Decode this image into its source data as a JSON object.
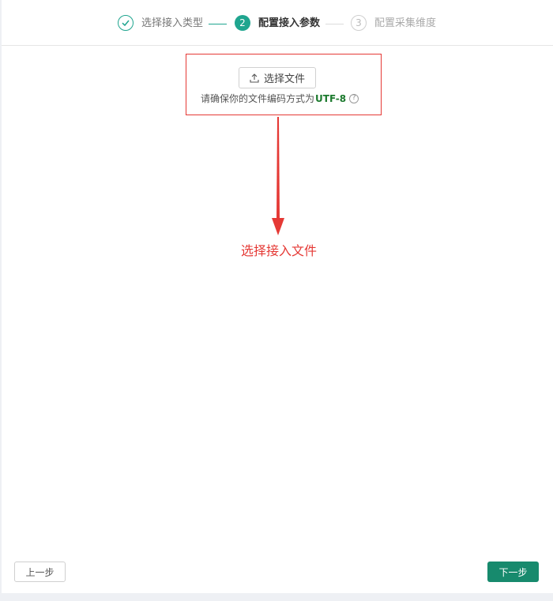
{
  "steps": [
    {
      "index": "1",
      "label": "选择接入类型",
      "status": "done"
    },
    {
      "index": "2",
      "label": "配置接入参数",
      "status": "active"
    },
    {
      "index": "3",
      "label": "配置采集维度",
      "status": "pending"
    }
  ],
  "upload": {
    "button_label": "选择文件",
    "hint_text": "请确保你的文件编码方式为",
    "encoding": "UTF-8"
  },
  "annotation": {
    "text": "选择接入文件"
  },
  "footer": {
    "prev_label": "上一步",
    "next_label": "下一步"
  },
  "colors": {
    "accent": "#1fa58f",
    "primary_button": "#178a6d",
    "annotation": "#e53935",
    "encoding_text": "#1c7a2e"
  },
  "icons": {
    "step1": "check-icon",
    "upload": "upload-icon",
    "help": "question-circle-icon"
  }
}
